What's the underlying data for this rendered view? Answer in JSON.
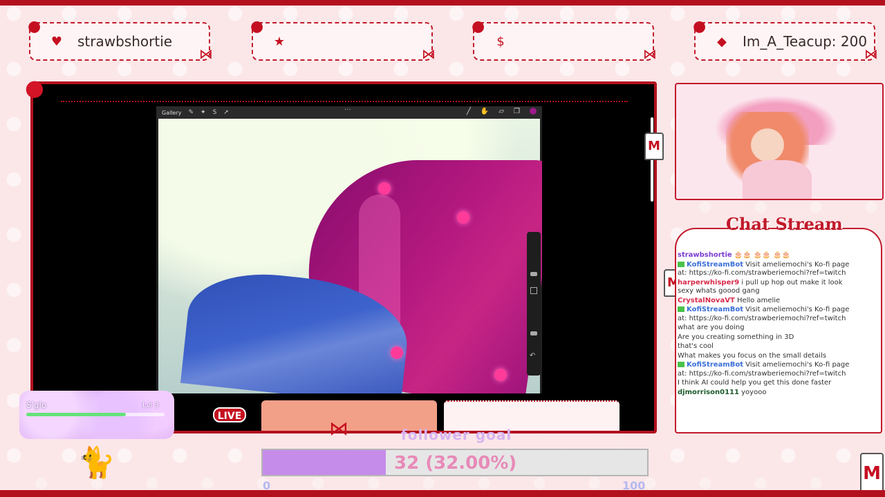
{
  "banners": [
    {
      "icon": "heart-icon",
      "glyph": "♥",
      "text": "strawbshortie"
    },
    {
      "icon": "star-icon",
      "glyph": "★",
      "text": ""
    },
    {
      "icon": "money-bag-icon",
      "glyph": "$",
      "text": ""
    },
    {
      "icon": "gem-icon",
      "glyph": "◆",
      "text": "Im_A_Teacup: 200"
    }
  ],
  "procreate": {
    "gallery_label": "Gallery",
    "more_glyph": "···"
  },
  "live_badge": "LIVE",
  "glow_widget": {
    "name": "S'glo",
    "level": "Lvl 3",
    "progress": 0.72
  },
  "follower_goal": {
    "title": "follower goal",
    "current": 32,
    "target": 100,
    "text": "32 (32.00%)",
    "min_label": "0",
    "max_label": "100",
    "fraction": 0.32
  },
  "chat": {
    "title": "Chat Stream",
    "messages": [
      {
        "user": "strawbshortie",
        "text": "🎂🎂 🎂🎂 🎂🎂",
        "color": "purple"
      },
      {
        "user": "KofiStreamBot",
        "text": "Visit ameliemochi's Ko-fi page at: https://ko-fi.com/strawberiemochi?ref=twitch",
        "color": "blue"
      },
      {
        "user": "harperwhisper9",
        "text": "i pull up hop out make it look sexy whats goood gang",
        "color": "red"
      },
      {
        "user": "CrystalNovaVT",
        "text": "Hello amelie",
        "color": "red"
      },
      {
        "user": "KofiStreamBot",
        "text": "Visit ameliemochi's Ko-fi page at: https://ko-fi.com/strawberiemochi?ref=twitch",
        "color": "blue"
      },
      {
        "user": "",
        "text": "what are you doing",
        "color": "lime"
      },
      {
        "user": "",
        "text": "Are you creating something in 3D",
        "color": "lime"
      },
      {
        "user": "",
        "text": "that's cool",
        "color": "lime"
      },
      {
        "user": "",
        "text": "What makes you focus on the small details",
        "color": "lime"
      },
      {
        "user": "KofiStreamBot",
        "text": "Visit ameliemochi's Ko-fi page at: https://ko-fi.com/strawberiemochi?ref=twitch",
        "color": "blue"
      },
      {
        "user": "",
        "text": "I think AI could help you get this done faster",
        "color": "lime"
      },
      {
        "user": "djmorrison0111",
        "text": "yoyooo",
        "color": "dark"
      }
    ]
  },
  "colors": {
    "accent": "#b3101e",
    "background": "#fbe6e8",
    "goal_fill": "#c58ce9",
    "goal_text": "#e88ab8",
    "live": "#c4101f"
  }
}
